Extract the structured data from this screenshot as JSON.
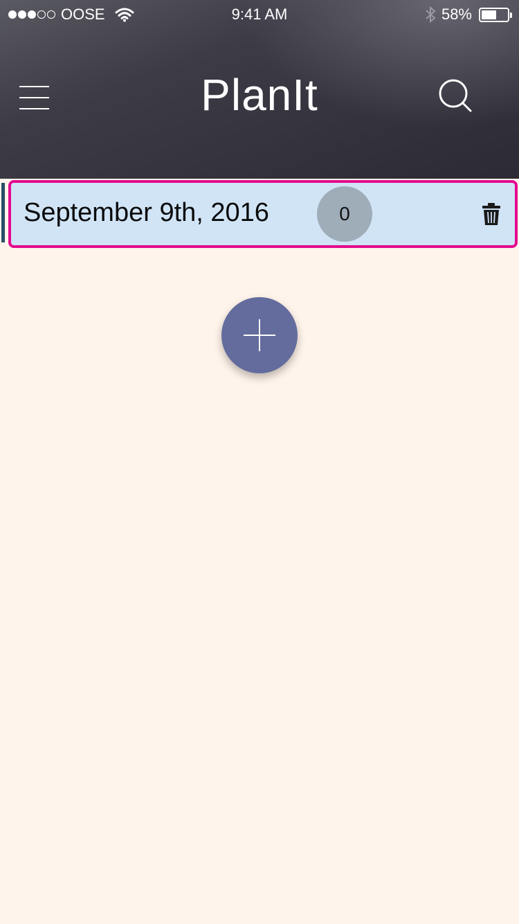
{
  "status_bar": {
    "signal_filled": 3,
    "signal_empty": 2,
    "carrier": "OOSE",
    "time": "9:41 AM",
    "battery_percent": "58%",
    "battery_level": 0.58,
    "icons": [
      "signal-dots-icon",
      "wifi-icon",
      "bluetooth-icon",
      "battery-icon"
    ]
  },
  "header": {
    "title": "PlanIt",
    "menu_icon": "hamburger-menu-icon",
    "search_icon": "search-icon"
  },
  "days": [
    {
      "title": "September 9th, 2016",
      "count": "0",
      "delete_icon": "trash-icon",
      "selected": true
    }
  ],
  "fab": {
    "icon": "plus-icon"
  },
  "colors": {
    "background": "#fff4eb",
    "header": "#2c2a34",
    "row_background": "#d0e4f6",
    "row_border_selected": "#e40b8f",
    "badge": "#9fadb9",
    "fab": "#636c9d",
    "row_accent": "#2b4e66"
  }
}
